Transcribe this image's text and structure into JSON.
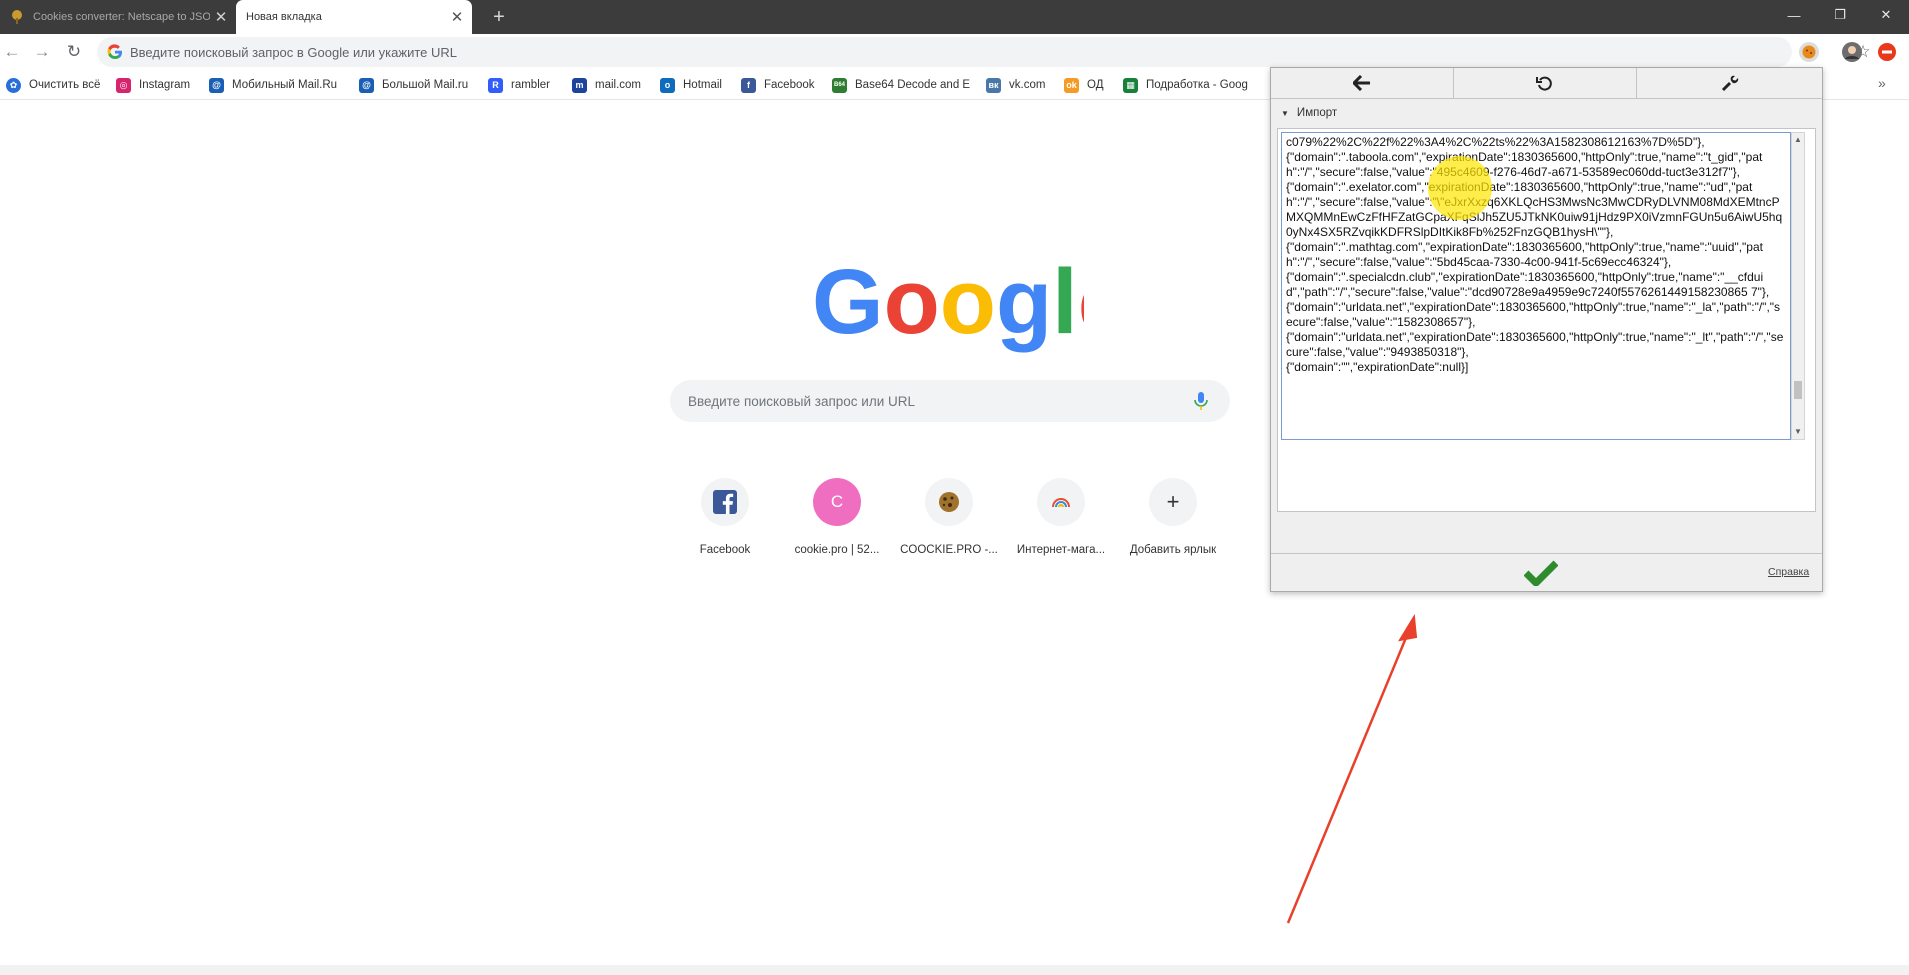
{
  "tabs": [
    {
      "title": "Cookies converter: Netscape to JSON",
      "close": "✕"
    },
    {
      "title": "Новая вкладка",
      "close": "✕"
    }
  ],
  "new_tab_symbol": "+",
  "window_controls": {
    "minimize": "—",
    "restore": "❐",
    "close": "✕"
  },
  "toolbar": {
    "back": "←",
    "forward": "→",
    "reload": "↻",
    "omnibox_placeholder": "Введите поисковый запрос в Google или укажите URL",
    "star": "☆"
  },
  "bookmarks": [
    {
      "label": "Очистить всё",
      "icon": "gear-icon",
      "color": "#2a6ed8"
    },
    {
      "label": "Instagram",
      "icon": "instagram-icon",
      "color": "#d6246e"
    },
    {
      "label": "Мобильный Mail.Ru",
      "icon": "mailru-icon",
      "color": "#1a5fb4"
    },
    {
      "label": "Большой Mail.ru",
      "icon": "mailru-icon",
      "color": "#1a5fb4"
    },
    {
      "label": "rambler",
      "icon": "rambler-icon",
      "color": "#315efb"
    },
    {
      "label": "mail.com",
      "icon": "mailcom-icon",
      "color": "#1c449b"
    },
    {
      "label": "Hotmail",
      "icon": "outlook-icon",
      "color": "#0f6cbd"
    },
    {
      "label": "Facebook",
      "icon": "facebook-icon",
      "color": "#3b5998"
    },
    {
      "label": "Base64 Decode and E",
      "icon": "base64-icon",
      "color": "#2e7d32"
    },
    {
      "label": "vk.com",
      "icon": "vk-icon",
      "color": "#4a76a8"
    },
    {
      "label": "ОД",
      "icon": "odnoklassniki-icon",
      "color": "#f59a23"
    },
    {
      "label": "Подработка - Goog",
      "icon": "sheets-icon",
      "color": "#188038"
    }
  ],
  "bookmarks_more": "»",
  "search": {
    "placeholder": "Введите поисковый запрос или URL"
  },
  "shortcuts": [
    {
      "label": "Facebook",
      "icon": "facebook-icon"
    },
    {
      "label": "cookie.pro | 52...",
      "icon": "letter-c-icon",
      "letter": "C"
    },
    {
      "label": "COOCKIE.PRO -...",
      "icon": "cookie-icon"
    },
    {
      "label": "Интернет-мага...",
      "icon": "rainbow-icon"
    },
    {
      "label": "Добавить ярлык",
      "icon": "plus-icon",
      "symbol": "+"
    }
  ],
  "popup": {
    "section_title": "Импорт",
    "import_text": "c079%22%2C%22f%22%3A4%2C%22ts%22%3A1582308612163%7D%5D\"},\n{\"domain\":\".taboola.com\",\"expirationDate\":1830365600,\"httpOnly\":true,\"name\":\"t_gid\",\"path\":\"/\",\"secure\":false,\"value\":\"495c4609-f276-46d7-a671-53589ec060dd-tuct3e312f7\"},\n{\"domain\":\".exelator.com\",\"expirationDate\":1830365600,\"httpOnly\":true,\"name\":\"ud\",\"path\":\"/\",\"secure\":false,\"value\":\"\\\"eJxrXxzq6XKLQcHS3MwsNc3MwCDRyDLVNM08MdXEMtncPMXQMMnEwCzFfHFZatGCpaXFqSlJh5ZU5JTkNK0uiw91jHdz9PX0iVzmnFGUn5u6AiwU5hq0yNx4SX5RZvqikKDFRSlpDItKik8Fb%252FnzGQB1hysH\\\"\"},\n{\"domain\":\".mathtag.com\",\"expirationDate\":1830365600,\"httpOnly\":true,\"name\":\"uuid\",\"path\":\"/\",\"secure\":false,\"value\":\"5bd45caa-7330-4c00-941f-5c69ecc46324\"},\n{\"domain\":\".specialcdn.club\",\"expirationDate\":1830365600,\"httpOnly\":true,\"name\":\"__cfduid\",\"path\":\"/\",\"secure\":false,\"value\":\"dcd90728e9a4959e9c7240f5576261449158230865 7\"},\n{\"domain\":\"urldata.net\",\"expirationDate\":1830365600,\"httpOnly\":true,\"name\":\"_la\",\"path\":\"/\",\"secure\":false,\"value\":\"1582308657\"},\n{\"domain\":\"urldata.net\",\"expirationDate\":1830365600,\"httpOnly\":true,\"name\":\"_lt\",\"path\":\"/\",\"secure\":false,\"value\":\"9493850318\"},\n{\"domain\":\"\",\"expirationDate\":null}]",
    "help_label": "Справка"
  },
  "colors": {
    "tab_strip": "#3c3c3c",
    "popup_bg": "#efefef",
    "confirm_green": "#2e8b2e",
    "cursor_highlight": "#ffe600",
    "annotation_arrow": "#e8402b"
  }
}
